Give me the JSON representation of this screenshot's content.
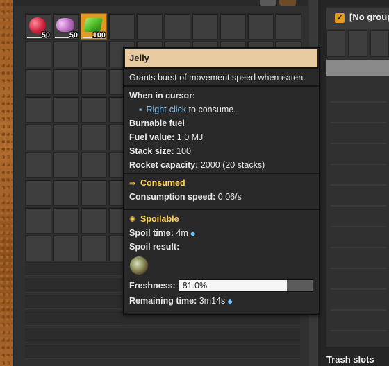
{
  "inventory": {
    "slots": [
      {
        "item": "red-fruit-icon",
        "count": "50"
      },
      {
        "item": "brain-coral-icon",
        "count": "50"
      },
      {
        "item": "jelly-icon",
        "count": "100",
        "selected": true
      }
    ]
  },
  "right_panel": {
    "title": "[No group",
    "footer": "Trash slots"
  },
  "tooltip": {
    "title": "Jelly",
    "description": "Grants burst of movement speed when eaten.",
    "cursor_header": "When in cursor:",
    "cursor_action_key": "Right-click",
    "cursor_action_text": "to consume.",
    "category": "Burnable fuel",
    "fuel_value_label": "Fuel value:",
    "fuel_value": "1.0 MJ",
    "stack_size_label": "Stack size:",
    "stack_size": "100",
    "rocket_capacity_label": "Rocket capacity:",
    "rocket_capacity": "2000 (20 stacks)",
    "consumed_header": "Consumed",
    "consumption_label": "Consumption speed:",
    "consumption_value": "0.06/s",
    "spoilable_header": "Spoilable",
    "spoil_time_label": "Spoil time:",
    "spoil_time": "4m",
    "spoil_result_label": "Spoil result:",
    "freshness_label": "Freshness:",
    "freshness_text": "81.0%",
    "freshness_fraction": 0.81,
    "remaining_label": "Remaining time:",
    "remaining_value": "3m14s"
  }
}
